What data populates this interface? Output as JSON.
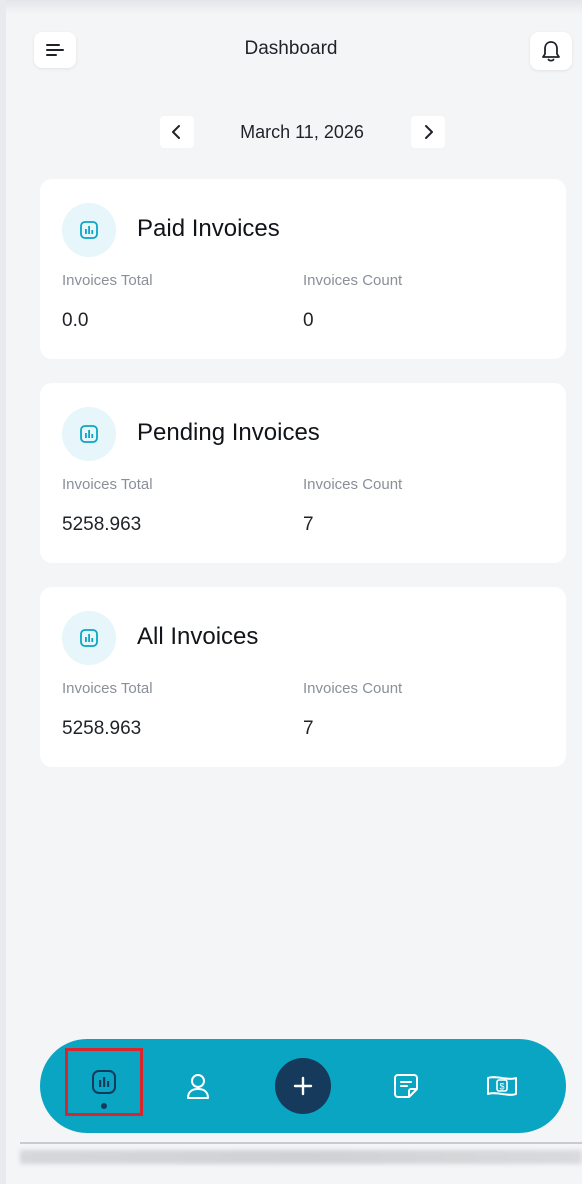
{
  "header": {
    "title": "Dashboard"
  },
  "date_nav": {
    "date": "March 11, 2026",
    "prev_icon": "chevron-left-icon",
    "next_icon": "chevron-right-icon"
  },
  "cards": [
    {
      "title": "Paid Invoices",
      "total_label": "Invoices Total",
      "count_label": "Invoices Count",
      "total": "0.0",
      "count": "0"
    },
    {
      "title": "Pending Invoices",
      "total_label": "Invoices Total",
      "count_label": "Invoices Count",
      "total": "5258.963",
      "count": "7"
    },
    {
      "title": "All Invoices",
      "total_label": "Invoices Total",
      "count_label": "Invoices Count",
      "total": "5258.963",
      "count": "7"
    }
  ],
  "bottom_nav": {
    "items": [
      {
        "name": "dashboard",
        "icon": "chart-icon",
        "active": true
      },
      {
        "name": "customers",
        "icon": "user-icon",
        "active": false
      },
      {
        "name": "add",
        "icon": "plus-icon",
        "active": false
      },
      {
        "name": "notes",
        "icon": "note-icon",
        "active": false
      },
      {
        "name": "payments",
        "icon": "money-icon",
        "active": false
      }
    ]
  },
  "colors": {
    "accent": "#0aa5c3",
    "dark": "#163a5c",
    "background": "#f4f5f7",
    "highlight": "#d9262c"
  }
}
